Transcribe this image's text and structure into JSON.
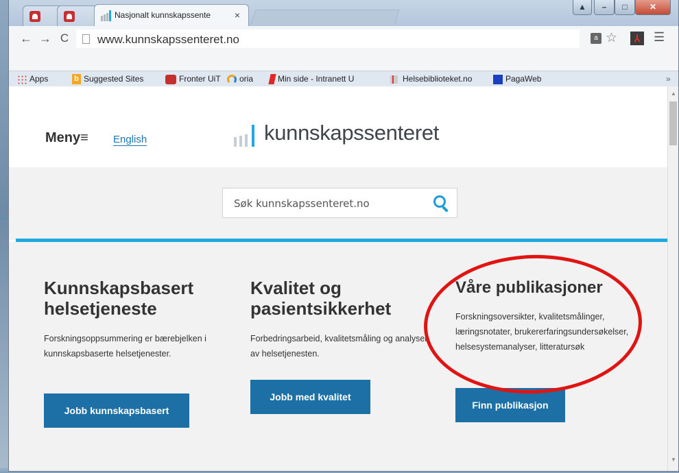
{
  "browser": {
    "tabs": [
      {
        "label": ""
      },
      {
        "label": ""
      },
      {
        "label": "Nasjonalt kunnskapssente",
        "close": "×"
      }
    ],
    "window_buttons": {
      "user": "▲",
      "minimize": "–",
      "maximize": "□",
      "close": "✕"
    },
    "nav": {
      "back": "←",
      "forward": "→",
      "reload": "C"
    },
    "url": "www.kunnskapssenteret.no",
    "bookmarks": [
      {
        "label": "Apps",
        "icon": "apps-grid-icon"
      },
      {
        "label": "Suggested Sites",
        "icon": "bing-icon"
      },
      {
        "label": "Fronter UiT",
        "icon": "fronter-icon"
      },
      {
        "label": "oria",
        "icon": "oria-icon"
      },
      {
        "label": "Min side - Intranett U",
        "icon": "uit-icon"
      },
      {
        "label": "Helsebiblioteket.no",
        "icon": "helsebiblioteket-icon"
      },
      {
        "label": "PagaWeb",
        "icon": "pagaweb-icon"
      }
    ],
    "bookmarks_overflow": "»"
  },
  "site": {
    "menu_label": "Meny",
    "menu_icon": "≡",
    "english_link": "English",
    "logo_text": "kunnskapssenteret",
    "search": {
      "placeholder": "Søk kunnskapssenteret.no"
    },
    "cards": [
      {
        "title": "Kunnskapsbasert helsetjeneste",
        "text": "Forskningsoppsummering er bærebjelken i kunnskapsbaserte helsetjenester.",
        "button": "Jobb kunnskapsbasert"
      },
      {
        "title": "Kvalitet og pasientsikkerhet",
        "text": "Forbedringsarbeid, kvalitetsmåling og analyser av helsetjenesten.",
        "button": "Jobb med kvalitet"
      },
      {
        "title": "Våre publikasjoner",
        "text": "Forskningsoversikter, kvalitetsmålinger, læringsnotater, brukererfaringsundersøkelser, helsesystemanalyser, litteratursøk",
        "button": "Finn publikasjon"
      }
    ]
  },
  "colors": {
    "accent_blue": "#1ea9e1",
    "button_blue": "#1d70a6",
    "annotation_red": "#e11414"
  }
}
